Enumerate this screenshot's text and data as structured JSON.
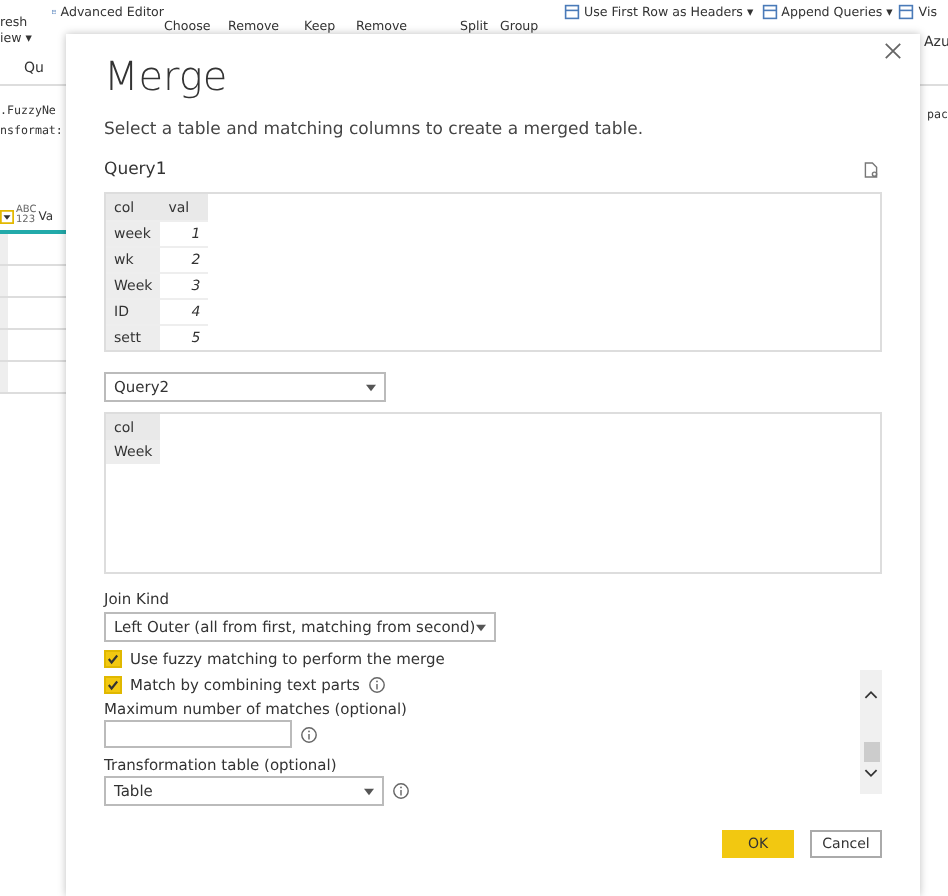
{
  "ribbon": {
    "refresh_lines": [
      "resh",
      "iew ▾"
    ],
    "group_label": "Qu",
    "items": [
      {
        "label": "Advanced Editor",
        "kind": "small"
      },
      {
        "label": "Choose",
        "kind": "large"
      },
      {
        "label": "Remove",
        "kind": "large"
      },
      {
        "label": "Keep",
        "kind": "large"
      },
      {
        "label": "Remove",
        "kind": "large"
      },
      {
        "label": "Split",
        "kind": "large"
      },
      {
        "label": "Group",
        "kind": "large"
      },
      {
        "label": "Use First Row as Headers ▾",
        "kind": "small"
      },
      {
        "label": "Append Queries ▾",
        "kind": "small"
      },
      {
        "label": "Vis",
        "kind": "small"
      }
    ],
    "right_label": "Azu"
  },
  "formula": {
    "lines": [
      ".FuzzyNe",
      "nsformat:"
    ],
    "right_text": "pac"
  },
  "grid": {
    "type_badge": "ABC\n123",
    "column": "Va"
  },
  "dialog": {
    "title": "Merge",
    "description": "Select a table and matching columns to create a merged table.",
    "first_table": {
      "name": "Query1",
      "columns": [
        "col",
        "val"
      ],
      "rows": [
        [
          "week",
          "1"
        ],
        [
          "wk",
          "2"
        ],
        [
          "Week",
          "3"
        ],
        [
          "ID",
          "4"
        ],
        [
          "sett",
          "5"
        ]
      ]
    },
    "second_table": {
      "name": "Query2",
      "columns": [
        "col"
      ],
      "rows": [
        [
          "Week"
        ]
      ]
    },
    "join_kind": {
      "label": "Join Kind",
      "value": "Left Outer (all from first, matching from second)"
    },
    "options": [
      {
        "label": "Use fuzzy matching to perform the merge",
        "checked": true,
        "info": false
      },
      {
        "label": "Match by combining text parts",
        "checked": true,
        "info": true
      }
    ],
    "max_matches": {
      "label": "Maximum number of matches (optional)"
    },
    "transformation": {
      "label": "Transformation table (optional)",
      "value": "Table"
    },
    "buttons": [
      {
        "label": "OK",
        "kind": "primary"
      },
      {
        "label": "Cancel",
        "kind": "secondary"
      }
    ]
  }
}
